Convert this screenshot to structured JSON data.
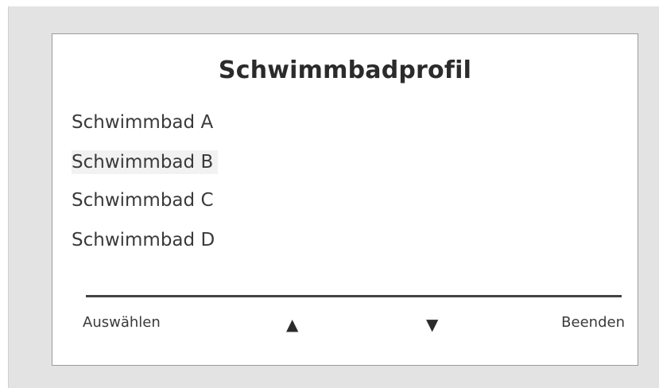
{
  "screen": {
    "title": "Schwimmbadprofil"
  },
  "options": [
    {
      "label": "Schwimmbad A",
      "selected": false
    },
    {
      "label": "Schwimmbad B",
      "selected": true
    },
    {
      "label": "Schwimmbad C",
      "selected": false
    },
    {
      "label": "Schwimmbad D",
      "selected": false
    }
  ],
  "softkeys": {
    "left_label": "Auswählen",
    "up_glyph": "▲",
    "up_icon": "triangle-up-icon",
    "down_glyph": "▼",
    "down_icon": "triangle-down-icon",
    "right_label": "Beenden"
  },
  "colors": {
    "frame": "#e3e3e3",
    "screen": "#ffffff",
    "text": "#3a3a3a",
    "divider": "#444444"
  }
}
